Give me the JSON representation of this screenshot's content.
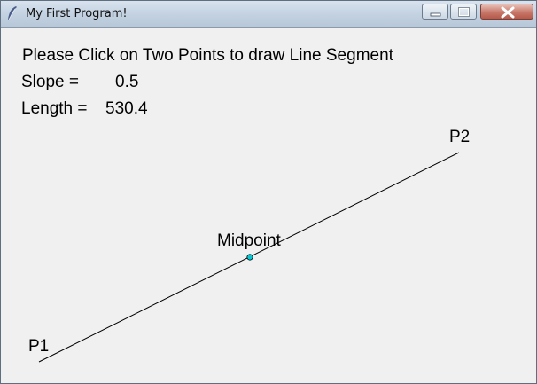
{
  "window": {
    "title": "My First Program!",
    "app_icon": "feather-icon",
    "controls": [
      "minimize-icon",
      "maximize-icon",
      "close-icon"
    ]
  },
  "canvas": {
    "instruction": "Please Click on Two Points to draw Line Segment",
    "slope_label": "Slope =",
    "slope_value": "0.5",
    "length_label": "Length =",
    "length_value": "530.4",
    "p1_label": "P1",
    "p2_label": "P2",
    "midpoint_label": "Midpoint",
    "midpoint_marker_color": "#00c8d7",
    "line_color": "#000000"
  }
}
